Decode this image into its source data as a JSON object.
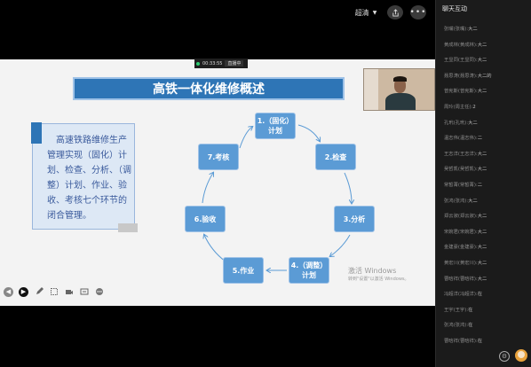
{
  "topbar": {
    "quality_label": "超清",
    "share_icon": "share-icon",
    "more_icon": "more-icon"
  },
  "timer": {
    "time": "00:33:55",
    "status": "直播中"
  },
  "slide": {
    "title": "高铁一体化维修概述",
    "body_text": "高速铁路维修生产管理实现（固化）计划、检查、分析、（调整）计划、作业、验收、考核七个环节的闭合管理。",
    "cycle_nodes": [
      {
        "line1": "1.（固化）",
        "line2": "计划"
      },
      {
        "line1": "2.检查",
        "line2": ""
      },
      {
        "line1": "3.分析",
        "line2": ""
      },
      {
        "line1": "4.（调整）",
        "line2": "计划"
      },
      {
        "line1": "5.作业",
        "line2": ""
      },
      {
        "line1": "6.验收",
        "line2": ""
      },
      {
        "line1": "7.考核",
        "line2": ""
      }
    ],
    "watermark_line1": "激活 Windows",
    "watermark_line2": "转到\"设置\"以激活 Windows。"
  },
  "toolbar_icons": [
    "back-icon",
    "play-icon",
    "pen-icon",
    "screenshot-icon",
    "camera-icon",
    "subtitle-icon",
    "more-icon"
  ],
  "sidebar": {
    "title": "聊天互动",
    "messages": [
      {
        "name": "张嘴(张嘴):",
        "text": "大二"
      },
      {
        "name": "黄成林(黄成林):",
        "text": "大二"
      },
      {
        "name": "王显同(王显同):",
        "text": "大二"
      },
      {
        "name": "聂思涛(聂思涛):",
        "text": "大二的"
      },
      {
        "name": "曾宪斯(曾宪斯):",
        "text": "大二"
      },
      {
        "name": "周玲(周主任):",
        "text": "2"
      },
      {
        "name": "孔玳(孔玳):",
        "text": "大二"
      },
      {
        "name": "温志伟(温志伟):",
        "text": "二"
      },
      {
        "name": "王志洋(王志洋):",
        "text": "大二"
      },
      {
        "name": "吴哲凯(吴哲凯):",
        "text": "大二"
      },
      {
        "name": "常皙菁(常皙菁):",
        "text": "二"
      },
      {
        "name": "张鸿(张鸿):",
        "text": "大二"
      },
      {
        "name": "郑云淑(郑云淑):",
        "text": "大二"
      },
      {
        "name": "宋婉君(宋婉君):",
        "text": "大二"
      },
      {
        "name": "金建豪(金建豪):",
        "text": "大二"
      },
      {
        "name": "黄宏川(黄宏川):",
        "text": "大二"
      },
      {
        "name": "曹晗祥(曹晗祥):",
        "text": "大二"
      },
      {
        "name": "冯超洋(冯超洋):",
        "text": "在"
      },
      {
        "name": "王宇(王宇):",
        "text": "在"
      },
      {
        "name": "张鸿(张鸿):",
        "text": "在"
      },
      {
        "name": "曹晗祥(曹晗祥):",
        "text": "在"
      }
    ]
  }
}
